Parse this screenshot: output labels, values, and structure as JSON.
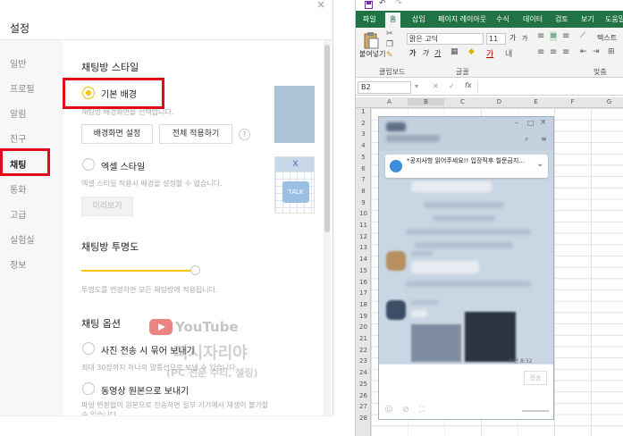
{
  "settings": {
    "title": "설정",
    "close": "×",
    "sidebar": [
      "일반",
      "프로필",
      "알림",
      "친구",
      "채팅",
      "통화",
      "고급",
      "실험실",
      "정보"
    ],
    "active_item": "채팅",
    "section_bg": {
      "title": "채팅방 스타일",
      "default_option": "기본 배경",
      "default_desc": "채팅방 배경화면을 선택합니다.",
      "btn_set_bg": "배경화면 설정",
      "btn_apply_all": "전체 적용하기",
      "help": "?",
      "excel_option": "엑셀 스타일",
      "excel_desc": "엑셀 스타일 적용시 배경을 설정할 수 없습니다.",
      "btn_preview": "미리보기",
      "preview_x": "X",
      "preview_talk": "TALK"
    },
    "section_opacity": {
      "title": "채팅방 투명도",
      "desc": "투명도를 변경하면 모든 채팅방에 적용됩니다.",
      "level": 1.0
    },
    "section_options": {
      "title": "채팅 옵션",
      "opt1": "사진 전송 시 묶어 보내기",
      "opt1_desc": "최대 30장까지 하나의 말풍선으로 보낼 수 있습니다.",
      "opt2": "동영상 원본으로 보내기",
      "opt2_desc1": "파일 변환없이 원본으로 전송하면 일부 기기에서 재생이 불가할",
      "opt2_desc2": "수 있습니다."
    },
    "watermark": {
      "line1": "YouTube",
      "line2": "피시자리야",
      "line3": "(PC 전문 수리, 셀링)"
    }
  },
  "excel": {
    "tabs": [
      "파일",
      "홈",
      "삽입",
      "페이지 레이아웃",
      "수식",
      "데이터",
      "검토",
      "보기",
      "도움말"
    ],
    "active_tab": "홈",
    "paste": "붙여넣기",
    "clipboard": "클립보드",
    "font_name": "맑은 고딕",
    "font_size": "11",
    "font_group": "글꼴",
    "align_group": "맞춤",
    "wrap": "텍스트",
    "name_box": "B2",
    "fx": "fx",
    "columns": [
      "A",
      "B",
      "C",
      "D",
      "E",
      "F",
      "G"
    ],
    "rows": [
      "1",
      "2",
      "3",
      "4",
      "5",
      "6",
      "7",
      "8",
      "9",
      "10",
      "11",
      "12",
      "13",
      "14",
      "15",
      "16",
      "17",
      "18",
      "19",
      "20",
      "21",
      "22",
      "23",
      "24",
      "25",
      "26",
      "27",
      "28"
    ]
  },
  "chat": {
    "notice": "*공지사항 읽어주세요!! 입장직후 칠문금지...",
    "time": "오전 8:32",
    "send": "전송"
  }
}
